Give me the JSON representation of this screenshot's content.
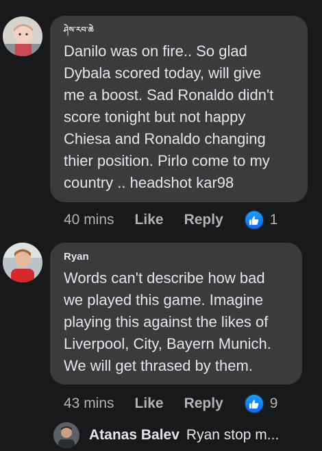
{
  "comments": [
    {
      "author": "ཤེས་རབ་ཆེ",
      "text": "Danilo was on fire.. So glad\nDybala scored today, will give\nme a boost. Sad Ronaldo didn't\nscore tonight but not happy\nChiesa and Ronaldo changing\nthier position. Pirlo come to my\ncountry .. headshot kar98",
      "time": "40 mins",
      "like_label": "Like",
      "reply_label": "Reply",
      "reaction_icon": "thumbs-up-icon",
      "reaction_count": "1"
    },
    {
      "author": "Ryan",
      "text": "Words can't describe how bad\nwe played this game. Imagine\nplaying this against the likes of\nLiverpool, City, Bayern Munich.\nWe will get thrased by them.",
      "time": "43 mins",
      "like_label": "Like",
      "reply_label": "Reply",
      "reaction_icon": "thumbs-up-icon",
      "reaction_count": "9"
    }
  ],
  "reply_preview": {
    "author": "Atanas Balev",
    "text": "Ryan stop m..."
  },
  "colors": {
    "background": "#18191a",
    "bubble": "#3a3b3c",
    "like_blue": "#0866ff"
  }
}
